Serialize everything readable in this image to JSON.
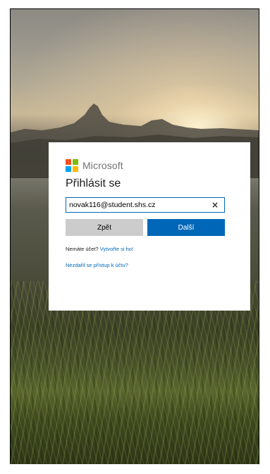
{
  "brand": {
    "name": "Microsoft",
    "logo_colors": [
      "#f25022",
      "#7fba00",
      "#00a4ef",
      "#ffb900"
    ]
  },
  "signin": {
    "title": "Přihlásit se",
    "email_value": "novak116@student.shs.cz",
    "clear_label": "×",
    "back_label": "Zpět",
    "next_label": "Další",
    "no_account_text": "Nemáte účet?",
    "create_link": "Vytvořte si ho!",
    "cant_access_link": "Nezdařil se přístup k účtu?"
  },
  "colors": {
    "accent": "#0067b8",
    "secondary_button": "#cccccc"
  }
}
